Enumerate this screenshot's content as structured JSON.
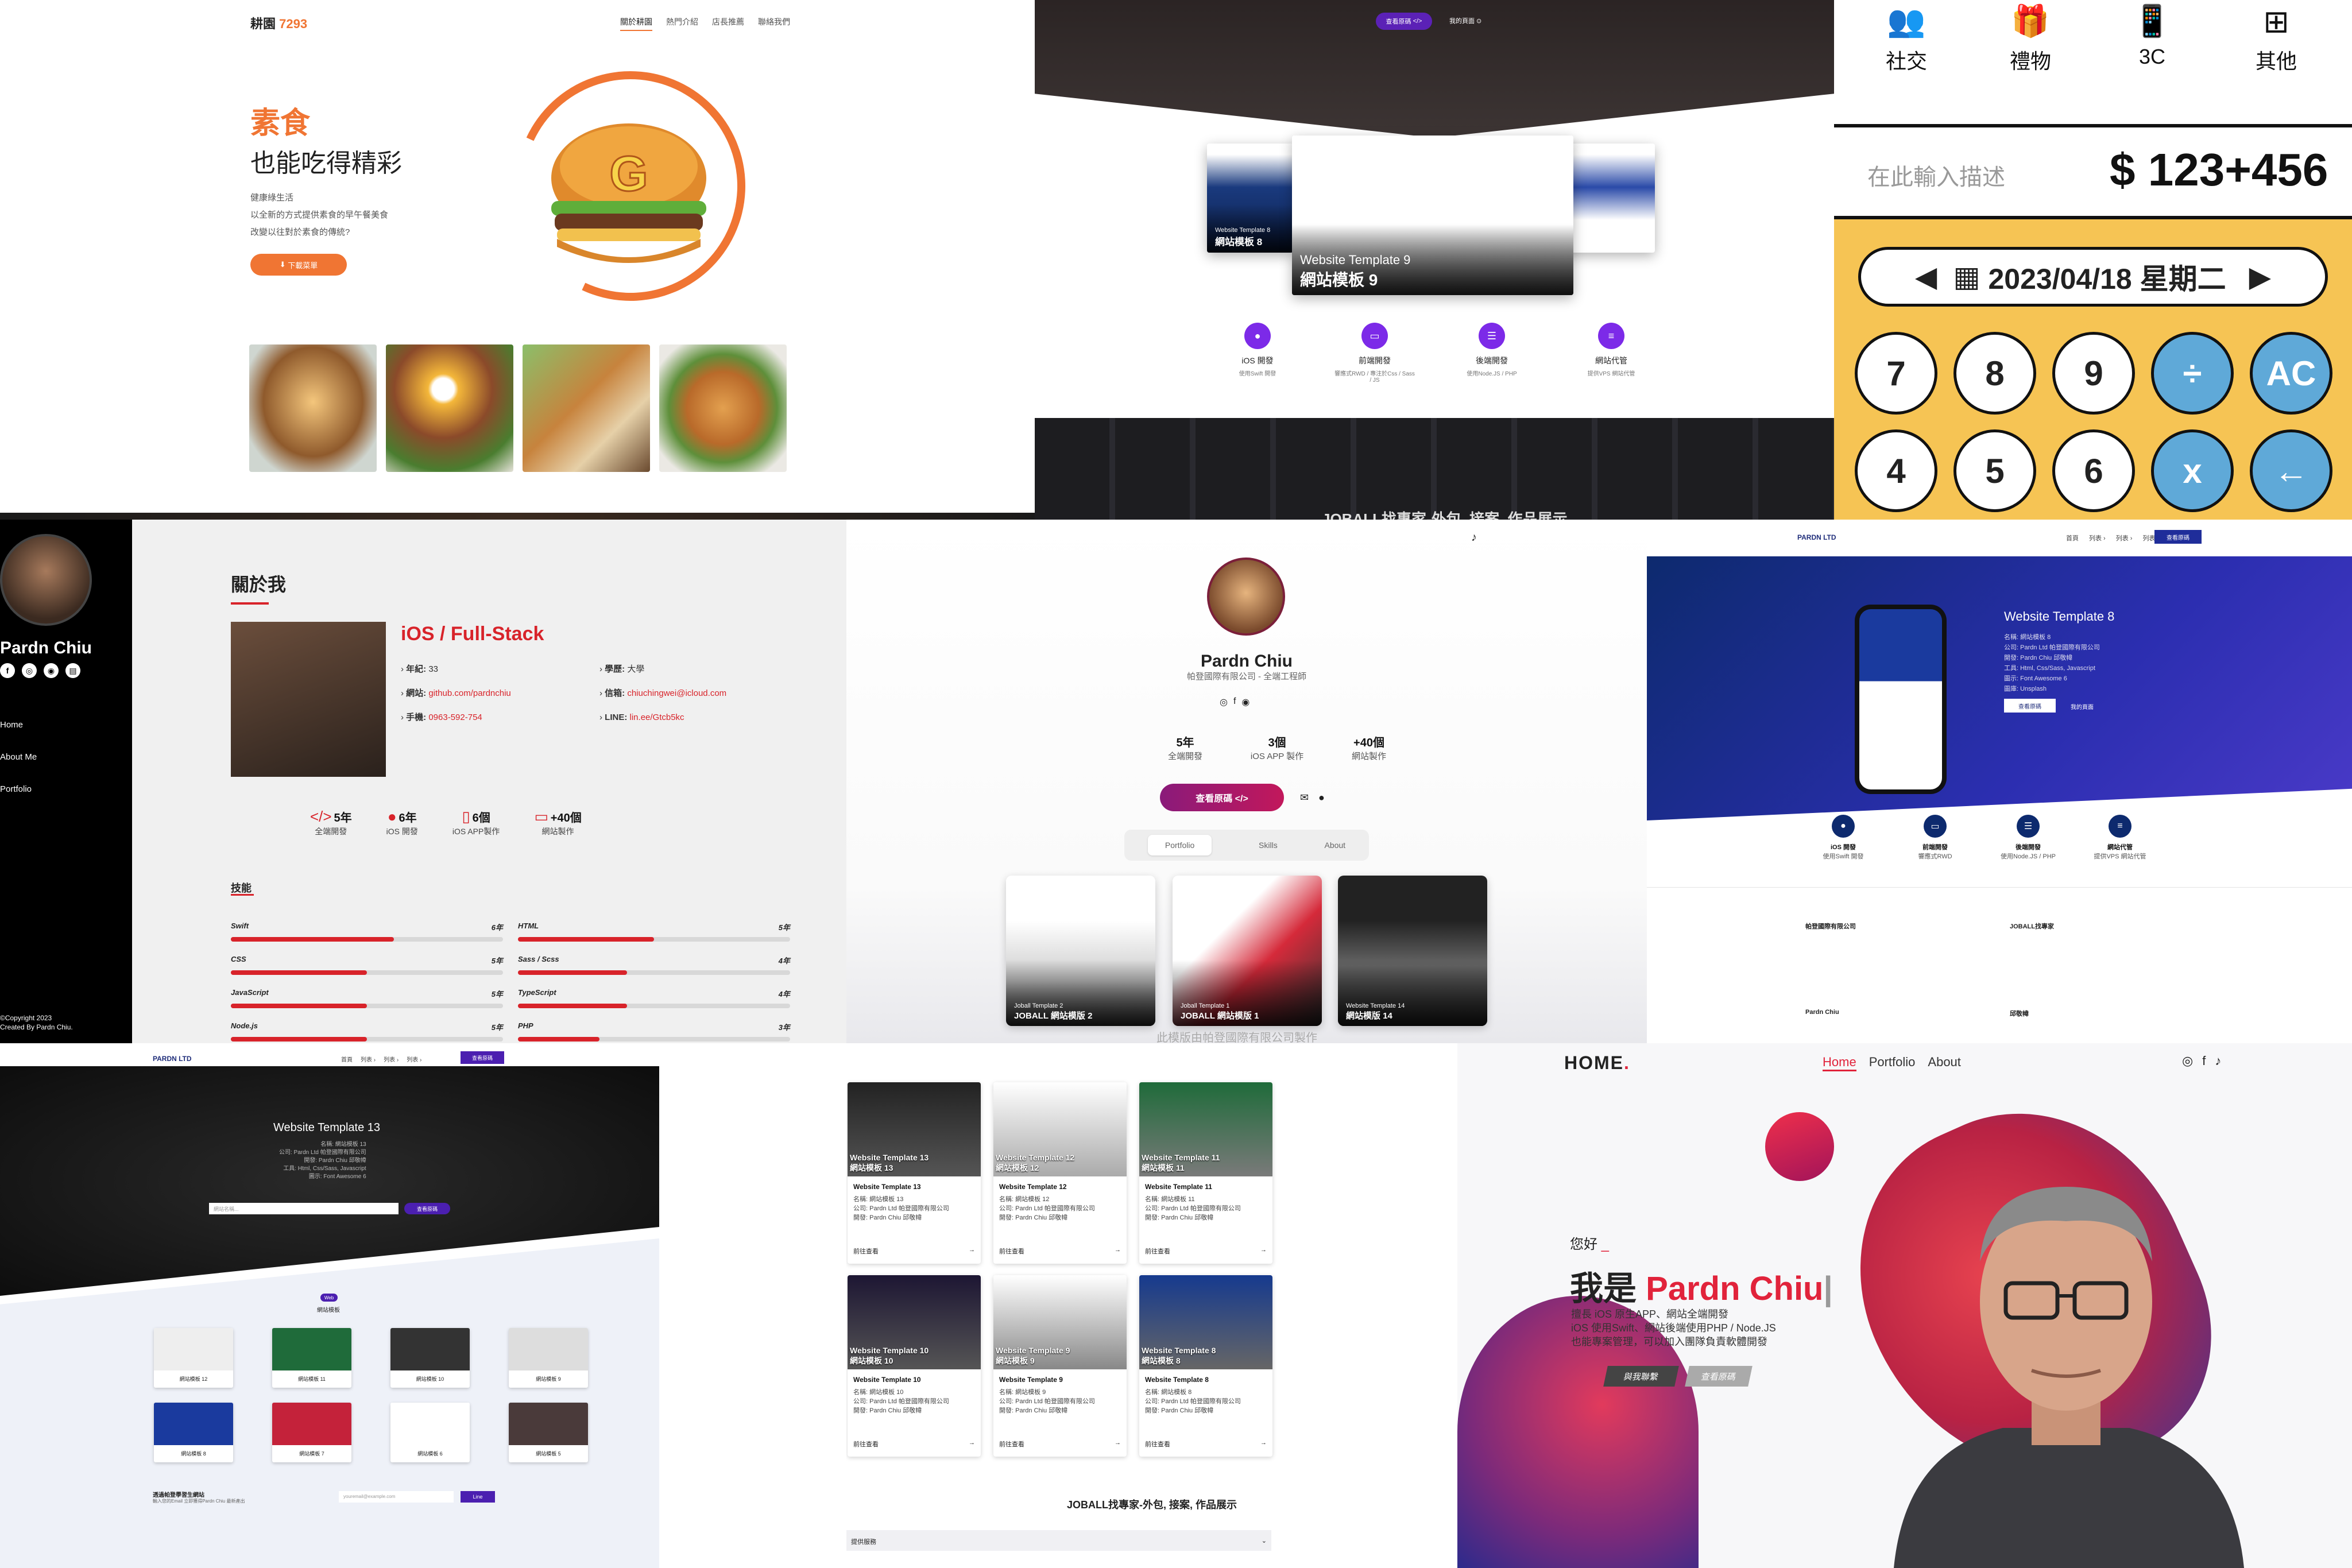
{
  "t1": {
    "logo_a": "耕園",
    "logo_b": "7293",
    "nav": [
      "關於耕園",
      "熱門介紹",
      "店長推薦",
      "聯絡我們"
    ],
    "title_a": "素食",
    "title_b": "也能吃得精彩",
    "desc": [
      "健康綠生活",
      "以全新的方式提供素食的早午餐美食",
      "改變以往對於素食的傳統?"
    ],
    "button": "下載菜單",
    "burger_letter": "G"
  },
  "t2": {
    "hero_btn": "查看原碼",
    "hero_link": "我的頁面",
    "shots": [
      {
        "en": "Website Template 8",
        "zh": "網站模板 8"
      },
      {
        "en": "Website Template 9",
        "zh": "網站模板 9"
      }
    ],
    "services": [
      {
        "title": "iOS 開發",
        "sub": "使用Swift 開發"
      },
      {
        "title": "前端開發",
        "sub": "響應式RWD / 專注於Css / Sass / JS"
      },
      {
        "title": "後端開發",
        "sub": "使用Node.JS / PHP"
      },
      {
        "title": "網站代管",
        "sub": "提供VPS 網站代管"
      }
    ],
    "band_title": "JOBALL找專家-外包, 接案, 作品展示"
  },
  "t3": {
    "categories": [
      {
        "icon": "users-icon",
        "label": "社交"
      },
      {
        "icon": "gift-icon",
        "label": "禮物"
      },
      {
        "icon": "phone-icon",
        "label": "3C"
      },
      {
        "icon": "grid-icon",
        "label": "其他"
      }
    ],
    "desc_placeholder": "在此輸入描述",
    "amount": "$ 123+456",
    "date": "2023/04/18 星期二",
    "keys": [
      "7",
      "8",
      "9",
      "÷",
      "AC",
      "4",
      "5",
      "6",
      "x",
      "←"
    ]
  },
  "t4": {
    "name": "Pardn Chiu",
    "menu": [
      "Home",
      "About Me",
      "Portfolio"
    ],
    "copyright": "©Copyright 2023",
    "created": "Created By Pardn Chiu.",
    "about_title": "關於我",
    "role": "iOS / Full-Stack",
    "info": [
      {
        "k": "年紀:",
        "v": "33"
      },
      {
        "k": "學歷:",
        "v": "大學"
      },
      {
        "k": "網站:",
        "v": "github.com/pardnchiu"
      },
      {
        "k": "信箱:",
        "v": "chiuchingwei@icloud.com"
      },
      {
        "k": "手機:",
        "v": "0963-592-754"
      },
      {
        "k": "LINE:",
        "v": "lin.ee/Gtcb5kc"
      }
    ],
    "stats": [
      {
        "icon": "</>",
        "value": "5年",
        "label": "全端開發"
      },
      {
        "icon": "",
        "value": "6年",
        "label": "iOS 開發"
      },
      {
        "icon": "▯",
        "value": "6個",
        "label": "iOS APP製作"
      },
      {
        "icon": "▭",
        "value": "+40個",
        "label": "網站製作"
      }
    ],
    "skills_title": "技能",
    "skills": [
      {
        "name": "Swift",
        "years": "6年",
        "level": 0.6
      },
      {
        "name": "HTML",
        "years": "5年",
        "level": 0.5
      },
      {
        "name": "CSS",
        "years": "5年",
        "level": 0.5
      },
      {
        "name": "Sass / Scss",
        "years": "4年",
        "level": 0.4
      },
      {
        "name": "JavaScript",
        "years": "5年",
        "level": 0.5
      },
      {
        "name": "TypeScript",
        "years": "4年",
        "level": 0.4
      },
      {
        "name": "Node.js",
        "years": "5年",
        "level": 0.5
      },
      {
        "name": "PHP",
        "years": "3年",
        "level": 0.3
      }
    ]
  },
  "t5": {
    "name": "Pardn Chiu",
    "sub": "帕登國際有限公司 - 全端工程師",
    "stats": [
      {
        "value": "5年",
        "label": "全端開發"
      },
      {
        "value": "3個",
        "label": "iOS APP 製作"
      },
      {
        "value": "+40個",
        "label": "網站製作"
      }
    ],
    "button": "查看原碼 </>",
    "tabs": [
      "Portfolio",
      "Skills",
      "About"
    ],
    "cards": [
      {
        "en": "Joball Template 2",
        "zh": "JOBALL 網站模版 2"
      },
      {
        "en": "Joball Template 1",
        "zh": "JOBALL 網站模版 1"
      },
      {
        "en": "Website Template 14",
        "zh": "網站模版 14"
      }
    ],
    "footer": "此模版由帕登國際有限公司製作"
  },
  "t6": {
    "brand": "PARDN LTD",
    "nav": [
      "首頁",
      "列表 ›",
      "列表 ›",
      "列表 ›"
    ],
    "title": "Website Template 8",
    "lines": [
      "名稱: 網站模板 8",
      "公司: Pardn Ltd 帕登國際有限公司",
      "開發: Pardn Chiu 邱敬幃",
      "工具: Html, Css/Sass, Javascript",
      "圖示: Font Awesome 6",
      "圖庫: Unsplash"
    ],
    "btn1": "查看原碼",
    "btn2": "我的頁面",
    "services": [
      {
        "title": "iOS 開發",
        "sub": "使用Swift 開發"
      },
      {
        "title": "前端開發",
        "sub": "響應式RWD"
      },
      {
        "title": "後端開發",
        "sub": "使用Node.JS / PHP"
      },
      {
        "title": "網站代管",
        "sub": "提供VPS 網站代管"
      }
    ],
    "companies": [
      "帕登國際有限公司",
      "JOBALL找專家",
      "Pardn Chiu",
      "邱敬幃"
    ]
  },
  "t7": {
    "brand": "PARDN LTD",
    "title": "Website Template 13",
    "lines": [
      "名稱: 網站模板 13",
      "公司: Pardn Ltd 帕登國際有限公司",
      "開發: Pardn Chiu 邱敬幃",
      "工具: Html, Css/Sass, Javascript",
      "圖示: Font Awesome 6"
    ],
    "search_placeholder": "網站名稱...",
    "search_btn": "查看原碼",
    "badge": "Web",
    "section": "網站模板",
    "cards": [
      "網站模板 12",
      "網站模板 11",
      "網站模板 10",
      "網站模板 9",
      "網站模板 8",
      "網站模板 7",
      "網站模板 6",
      "網站模板 5"
    ],
    "sub_title": "透過帕登學習生網站",
    "sub_desc": "輸入您的Email 立即獲得Pardn Chiu 最新產出",
    "email_placeholder": "youremail@example.com",
    "sub_btn": "Line"
  },
  "t8": {
    "cards": [
      {
        "en": "Website Template 13",
        "zh": "網站模板 13",
        "n": "13"
      },
      {
        "en": "Website Template 12",
        "zh": "網站模板 12",
        "n": "12"
      },
      {
        "en": "Website Template 11",
        "zh": "網站模板 11",
        "n": "11"
      },
      {
        "en": "Website Template 10",
        "zh": "網站模板 10",
        "n": "10"
      },
      {
        "en": "Website Template 9",
        "zh": "網站模板 9",
        "n": "9"
      },
      {
        "en": "Website Template 8",
        "zh": "網站模板 8",
        "n": "8"
      }
    ],
    "company": "公司: Pardn Ltd 帕登國際有限公司",
    "dev": "開發: Pardn Chiu 邱敬幃",
    "more": "前往查看",
    "heading": "JOBALL找專家-外包, 接案, 作品展示",
    "faq": "提供服務"
  },
  "t9": {
    "logo": "HOME",
    "nav": [
      "Home",
      "Portfolio",
      "About"
    ],
    "greeting": "您好",
    "name_a": "我是",
    "name_b": "Pardn Chiu",
    "desc": [
      "擅長 iOS 原生APP、網站全端開發",
      "iOS 使用Swift、網站後端使用PHP / Node.JS",
      "也能專案管理，可以加入團隊負責軟體開發"
    ],
    "btn1": "與我聯繫",
    "btn2": "查看原碼"
  }
}
